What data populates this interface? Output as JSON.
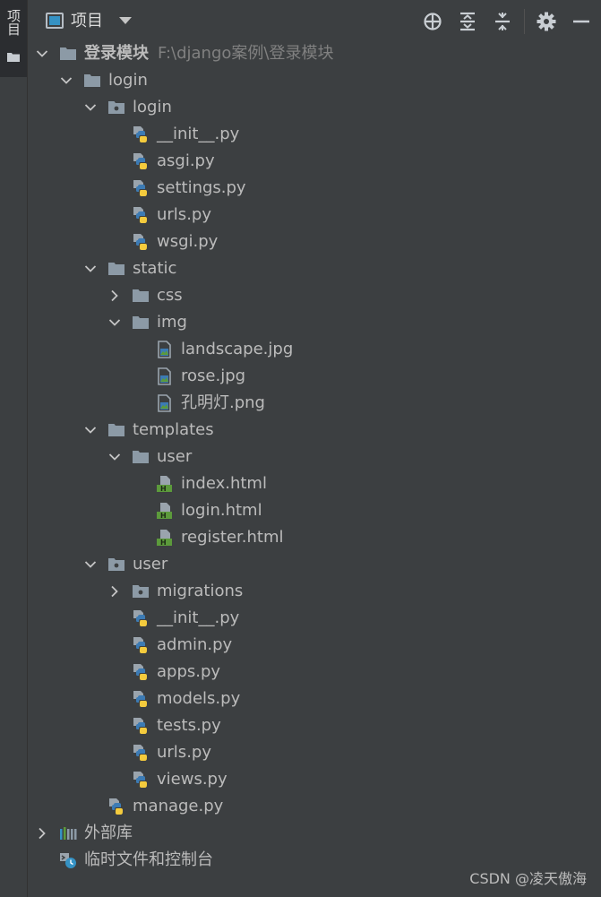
{
  "side_strip": {
    "tab_label": "项目"
  },
  "header": {
    "title": "项目"
  },
  "tree": [
    {
      "label": "登录模块",
      "path": "F:\\django案例\\登录模块",
      "depth": 0,
      "type": "folder",
      "expanded": true,
      "bold": true
    },
    {
      "label": "login",
      "depth": 1,
      "type": "folder",
      "expanded": true
    },
    {
      "label": "login",
      "depth": 2,
      "type": "package",
      "expanded": true
    },
    {
      "label": "__init__.py",
      "depth": 3,
      "type": "python"
    },
    {
      "label": "asgi.py",
      "depth": 3,
      "type": "python"
    },
    {
      "label": "settings.py",
      "depth": 3,
      "type": "python"
    },
    {
      "label": "urls.py",
      "depth": 3,
      "type": "python"
    },
    {
      "label": "wsgi.py",
      "depth": 3,
      "type": "python"
    },
    {
      "label": "static",
      "depth": 2,
      "type": "folder",
      "expanded": true
    },
    {
      "label": "css",
      "depth": 3,
      "type": "folder",
      "expanded": false
    },
    {
      "label": "img",
      "depth": 3,
      "type": "folder",
      "expanded": true
    },
    {
      "label": "landscape.jpg",
      "depth": 4,
      "type": "image"
    },
    {
      "label": "rose.jpg",
      "depth": 4,
      "type": "image"
    },
    {
      "label": "孔明灯.png",
      "depth": 4,
      "type": "image"
    },
    {
      "label": "templates",
      "depth": 2,
      "type": "folder",
      "expanded": true
    },
    {
      "label": "user",
      "depth": 3,
      "type": "folder",
      "expanded": true
    },
    {
      "label": "index.html",
      "depth": 4,
      "type": "html"
    },
    {
      "label": "login.html",
      "depth": 4,
      "type": "html"
    },
    {
      "label": "register.html",
      "depth": 4,
      "type": "html"
    },
    {
      "label": "user",
      "depth": 2,
      "type": "package",
      "expanded": true
    },
    {
      "label": "migrations",
      "depth": 3,
      "type": "package",
      "expanded": false
    },
    {
      "label": "__init__.py",
      "depth": 3,
      "type": "python"
    },
    {
      "label": "admin.py",
      "depth": 3,
      "type": "python"
    },
    {
      "label": "apps.py",
      "depth": 3,
      "type": "python"
    },
    {
      "label": "models.py",
      "depth": 3,
      "type": "python"
    },
    {
      "label": "tests.py",
      "depth": 3,
      "type": "python"
    },
    {
      "label": "urls.py",
      "depth": 3,
      "type": "python"
    },
    {
      "label": "views.py",
      "depth": 3,
      "type": "python"
    },
    {
      "label": "manage.py",
      "depth": 2,
      "type": "python"
    },
    {
      "label": "外部库",
      "depth": 0,
      "type": "library",
      "expanded": false
    },
    {
      "label": "临时文件和控制台",
      "depth": 0,
      "type": "scratch"
    }
  ],
  "watermark": "CSDN @凌天傲海",
  "colors": {
    "background": "#3c3f41",
    "text": "#bbbbbb",
    "path_text": "#808080",
    "folder": "#8c9aa6",
    "python_blue": "#3c7bb4",
    "python_yellow": "#f4cb3d",
    "html_green": "#5c9a3b",
    "accent": "#3592c4"
  }
}
